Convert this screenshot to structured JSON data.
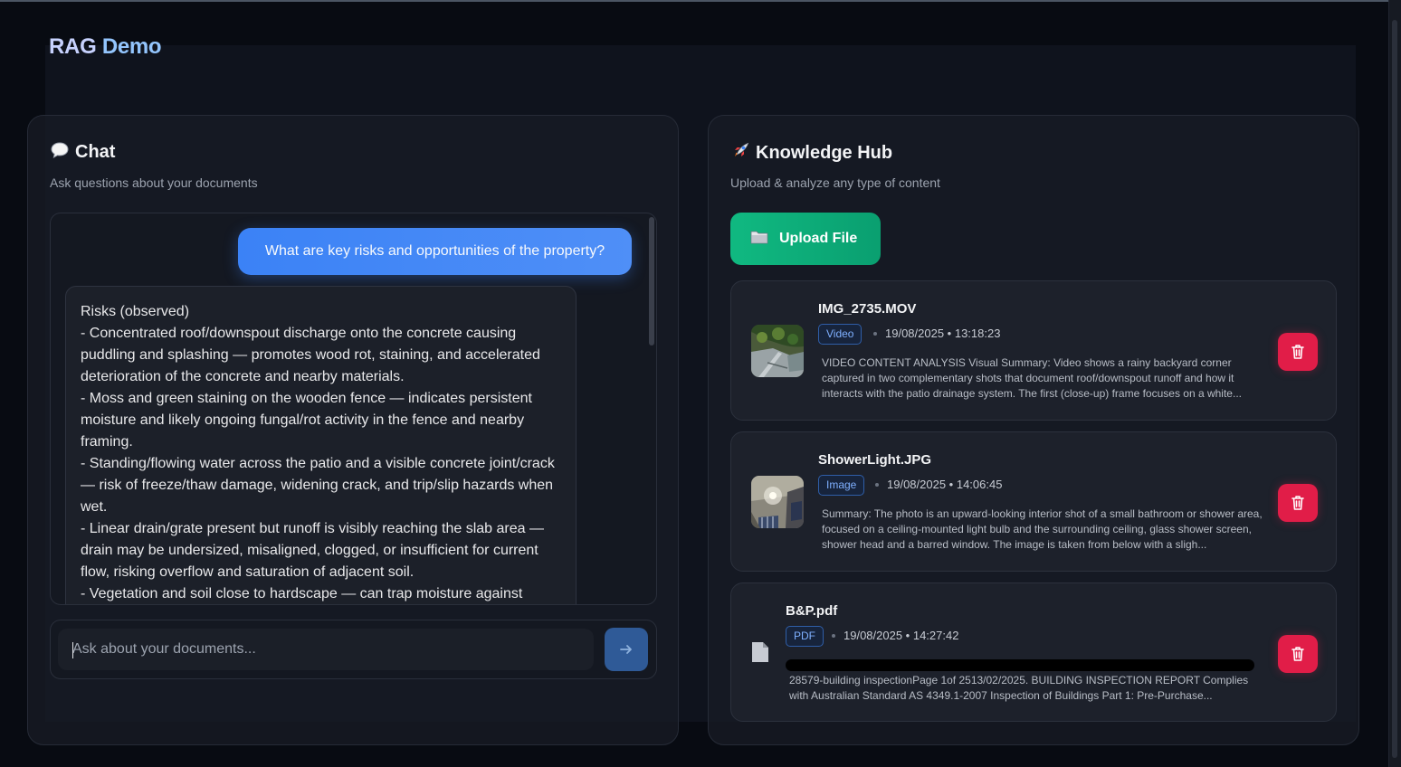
{
  "app": {
    "title_part1": "RAG",
    "title_part2": "Demo"
  },
  "chat": {
    "icon": "speech-bubble-icon",
    "title": "Chat",
    "subtitle": "Ask questions about your documents",
    "user_message": "What are key risks and opportunities of the property?",
    "assistant_lines": [
      "Risks (observed)",
      "- Concentrated roof/downspout discharge onto the concrete causing puddling and splashing — promotes wood rot, staining, and accelerated deterioration of the concrete and nearby materials.",
      "- Moss and green staining on the wooden fence — indicates persistent moisture and likely ongoing fungal/rot activity in the fence and nearby framing.",
      "- Standing/flowing water across the patio and a visible concrete joint/crack — risk of freeze/thaw damage, widening crack, and trip/slip hazards when wet.",
      "- Linear drain/grate present but runoff is visibly reaching the slab area — drain may be undersized, misaligned, clogged, or insufficient for current flow, risking overflow and saturation of adjacent soil.",
      "- Vegetation and soil close to hardscape — can trap moisture against"
    ],
    "input_placeholder": "Ask about your documents...",
    "send_icon": "arrow-right-icon"
  },
  "hub": {
    "icon": "rocket-icon",
    "title": "Knowledge Hub",
    "subtitle": "Upload & analyze any type of content",
    "upload_label": "Upload File",
    "upload_icon": "folder-icon",
    "files": [
      {
        "name": "IMG_2735.MOV",
        "type": "Video",
        "date": "19/08/2025 • 13:18:23",
        "description": "VIDEO CONTENT ANALYSIS Visual Summary: Video shows a rainy backyard corner captured in two complementary shots that document roof/downspout runoff and how it interacts with the patio drainage system. The first (close-up) frame focuses on a white...",
        "thumb": "video-thumbnail"
      },
      {
        "name": "ShowerLight.JPG",
        "type": "Image",
        "date": "19/08/2025 • 14:06:45",
        "description": "Summary: The photo is an upward-looking interior shot of a small bathroom or shower area, focused on a ceiling-mounted light bulb and the surrounding ceiling, glass shower screen, shower head and a barred window. The image is taken from below with a sligh...",
        "thumb": "image-thumbnail"
      },
      {
        "name": "B&P.pdf",
        "type": "PDF",
        "date": "19/08/2025 • 14:27:42",
        "description": "28579-building inspectionPage 1of 2513/02/2025. BUILDING INSPECTION REPORT Complies with Australian Standard AS 4349.1-2007 Inspection of Buildings Part 1: Pre-Purchase...",
        "thumb": "document-icon"
      }
    ],
    "delete_icon": "trash-icon"
  },
  "colors": {
    "accent_blue": "#3b82f6",
    "upload_green": "#10b981",
    "delete_red": "#e11d48"
  }
}
